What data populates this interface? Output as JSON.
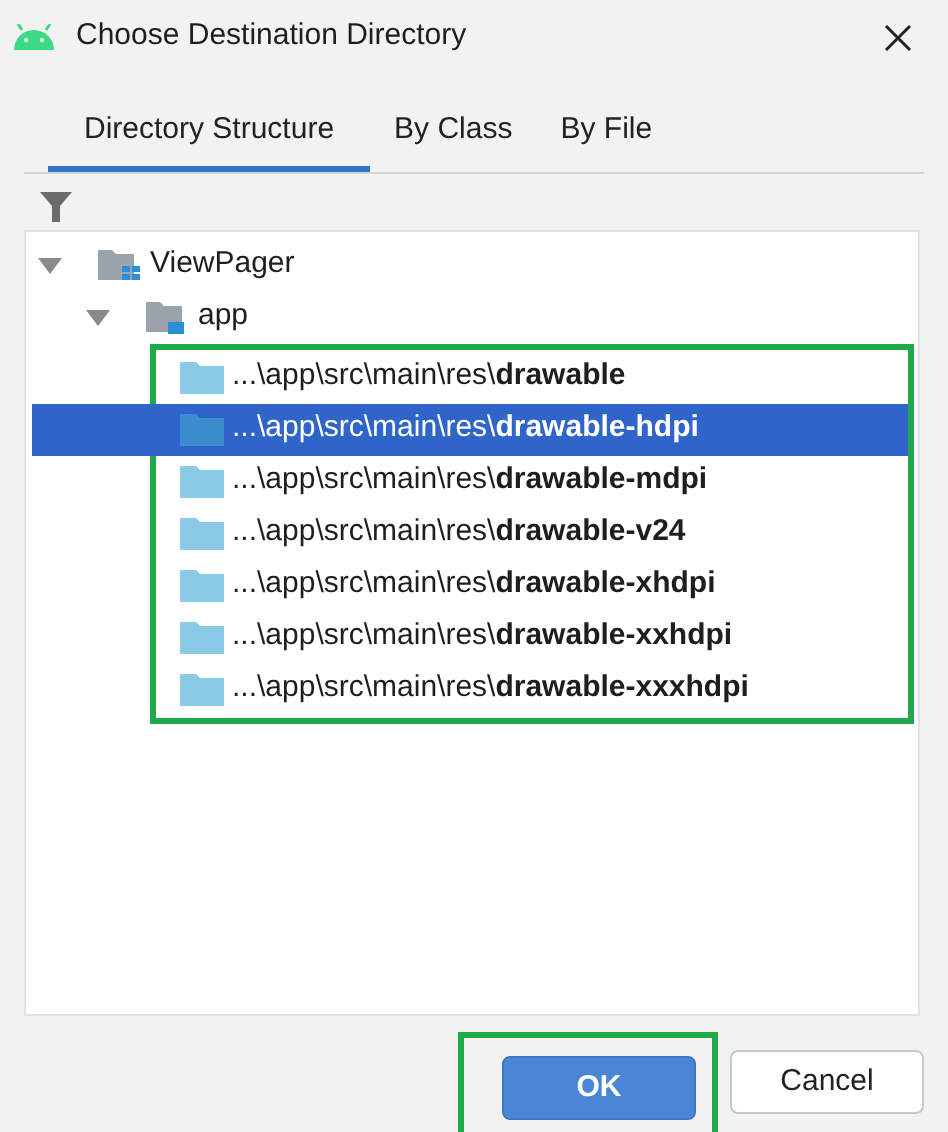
{
  "window": {
    "title": "Choose Destination Directory"
  },
  "tabs": [
    {
      "label": "Directory Structure",
      "selected": true
    },
    {
      "label": "By Class",
      "selected": false
    },
    {
      "label": "By File",
      "selected": false
    }
  ],
  "tree": [
    {
      "label": "ViewPager",
      "kind": "project",
      "expanded": true,
      "children": [
        {
          "label": "app",
          "kind": "module",
          "expanded": true,
          "children_highlighted": true,
          "children": [
            {
              "label": "...\\app\\src\\main\\res\\**drawable**",
              "kind": "folder",
              "selected": false
            },
            {
              "label": "...\\app\\src\\main\\res\\**drawable-hdpi**",
              "kind": "folder",
              "selected": true
            },
            {
              "label": "...\\app\\src\\main\\res\\**drawable-mdpi**",
              "kind": "folder",
              "selected": false
            },
            {
              "label": "...\\app\\src\\main\\res\\**drawable-v24**",
              "kind": "folder",
              "selected": false
            },
            {
              "label": "...\\app\\src\\main\\res\\**drawable-xhdpi**",
              "kind": "folder",
              "selected": false
            },
            {
              "label": "...\\app\\src\\main\\res\\**drawable-xxhdpi**",
              "kind": "folder",
              "selected": false
            },
            {
              "label": "...\\app\\src\\main\\res\\**drawable-xxxhdpi**",
              "kind": "folder",
              "selected": false
            }
          ]
        }
      ]
    }
  ],
  "buttons": [
    {
      "label": "OK",
      "kind": "primary",
      "highlighted": true
    },
    {
      "label": "Cancel",
      "kind": "secondary",
      "highlighted": false
    }
  ]
}
